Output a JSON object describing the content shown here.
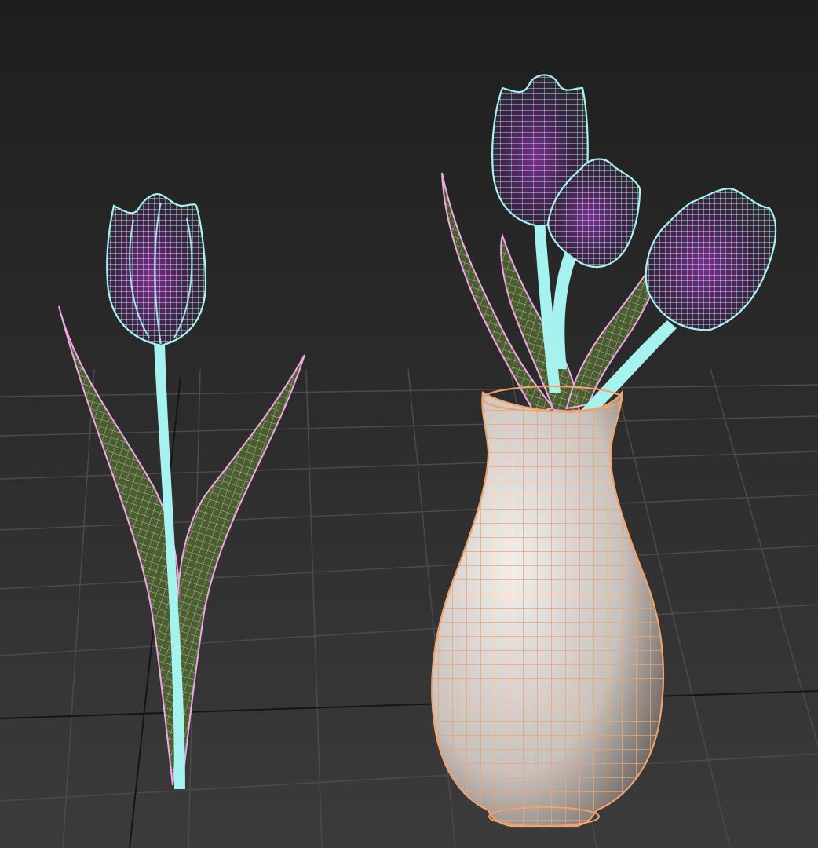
{
  "viewport": {
    "background_top": "#1f1f1f",
    "background_bottom": "#3a3a3a",
    "grid_color": "#4a4a4a",
    "grid_axis_color": "#141414"
  },
  "scene": {
    "objects": [
      {
        "name": "tulip-single",
        "wire_color_bloom": "#a6f2ee",
        "wire_color_leaf": "#f2a6e6",
        "fill_leaf": "#4e6b2a"
      },
      {
        "name": "tulip-bouquet",
        "wire_color_bloom": "#a6f2ee",
        "wire_color_leaf": "#f2a6e6",
        "fill_leaf": "#4e6b2a"
      },
      {
        "name": "vase",
        "wire_color": "#f0a36c",
        "fill": "#c9c3bf"
      }
    ]
  }
}
